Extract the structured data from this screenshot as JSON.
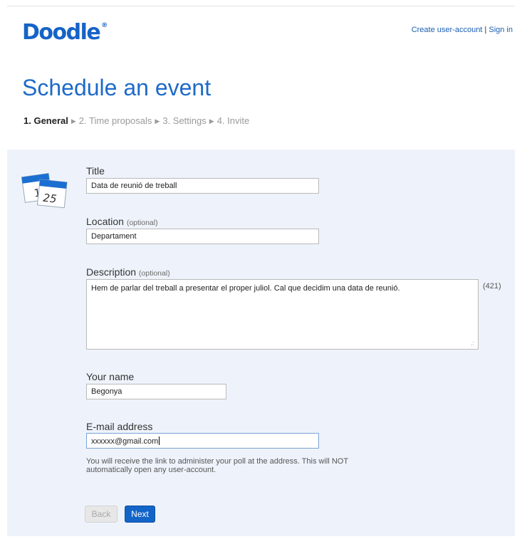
{
  "header": {
    "logo": "Doodle",
    "logo_mark": "®",
    "create_account": "Create user-account",
    "separator": " | ",
    "sign_in": "Sign in"
  },
  "page": {
    "title": "Schedule an event",
    "steps": [
      "1. General",
      "2. Time proposals",
      "3. Settings",
      "4. Invite"
    ]
  },
  "calendar_icon": {
    "numbers": [
      "1",
      "25"
    ]
  },
  "form": {
    "title_label": "Title",
    "title_value": "Data de reunió de treball",
    "location_label": "Location",
    "location_optional": "(optional)",
    "location_value": "Departament",
    "description_label": "Description",
    "description_optional": "(optional)",
    "description_value": "Hem de parlar del treball a presentar el proper juliol. Cal que decidim una data de reunió.",
    "description_count": "(421)",
    "name_label": "Your name",
    "name_value": "Begonya",
    "email_label": "E-mail address",
    "email_value": "xxxxxx@gmail.com",
    "email_help": "You will receive the link to administer your poll at the address. This will NOT automatically open any user-account.",
    "back_label": "Back",
    "next_label": "Next"
  },
  "colors": {
    "brand": "#1563c7",
    "panel_bg": "#eef3fb",
    "next_button": "#1364c8"
  }
}
